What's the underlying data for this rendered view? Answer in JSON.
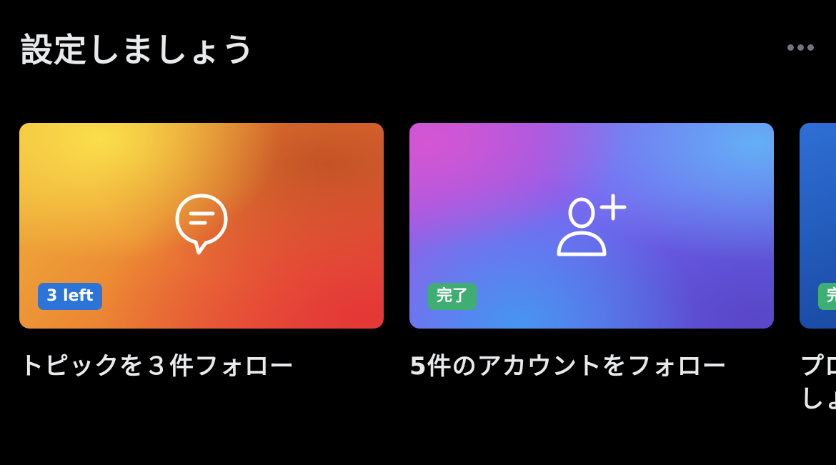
{
  "header": {
    "title": "設定しましょう",
    "more_icon": "more-horizontal-icon"
  },
  "cards": [
    {
      "icon": "topic-speech-bubble-icon",
      "badge": "3 left",
      "label": "トピックを３件フォロー",
      "colors": [
        "#fade4a",
        "#ec8a34",
        "#e43737"
      ]
    },
    {
      "icon": "person-add-icon",
      "badge": "完了",
      "label": "5件のアカウントをフォロー",
      "colors": [
        "#d456d2",
        "#7b62f0",
        "#64aff5"
      ]
    },
    {
      "icon": "",
      "badge": "完",
      "label": "プロ しょう",
      "colors": [
        "#2f6fd6",
        "#163f8c"
      ]
    }
  ],
  "colors": {
    "badge_left": "#2d74d9",
    "badge_done": "#3fae73",
    "text": "#e7e9ea",
    "muted": "#71767b",
    "background": "#000000"
  }
}
